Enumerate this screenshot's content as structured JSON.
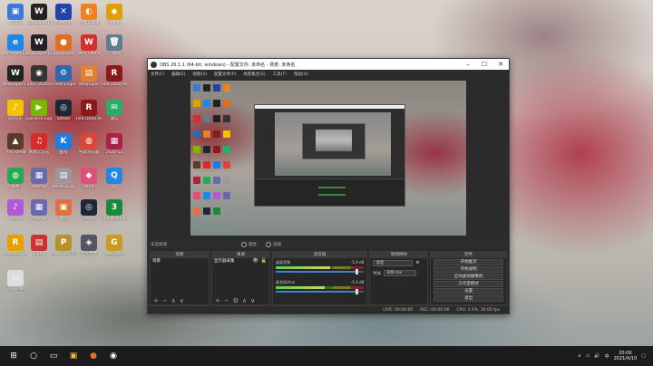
{
  "desktop": {
    "icons": [
      {
        "label": "此电脑",
        "glyph": "▣",
        "color": "#3a7bd5"
      },
      {
        "label": "Wallpaper Engine",
        "glyph": "W",
        "color": "#222"
      },
      {
        "label": "Minecraft",
        "glyph": "✕",
        "color": "#2244aa"
      },
      {
        "label": "小丸工具箱",
        "glyph": "◐",
        "color": "#f08020"
      },
      {
        "label": "Fences",
        "glyph": "◆",
        "color": "#e0a000"
      },
      {
        "label": "Microsoft Edge",
        "glyph": "e",
        "color": "#1e88e5"
      },
      {
        "label": "Wallpaper Engine",
        "glyph": "W",
        "color": "#222"
      },
      {
        "label": "Bandicam",
        "glyph": "●",
        "color": "#e07020"
      },
      {
        "label": "WPS Office",
        "glyph": "W",
        "color": "#d32f2f"
      },
      {
        "label": "回收站",
        "glyph": "🗑",
        "color": "#607d8b"
      },
      {
        "label": "Wallpaper Engine",
        "glyph": "W",
        "color": "#222"
      },
      {
        "label": "OBS Studio",
        "glyph": "◉",
        "color": "#333"
      },
      {
        "label": "Cheat Engine",
        "glyph": "⚙",
        "color": "#2a6ab3"
      },
      {
        "label": "Wallpaper",
        "glyph": "▤",
        "color": "#e08030"
      },
      {
        "label": "Red Dead Redemption",
        "glyph": "R",
        "color": "#8a1a1a"
      },
      {
        "label": "QQ音乐",
        "glyph": "♪",
        "color": "#f3c200"
      },
      {
        "label": "GeForce Experience",
        "glyph": "▶",
        "color": "#76b900"
      },
      {
        "label": "Steam",
        "glyph": "◎",
        "color": "#1b2838"
      },
      {
        "label": "Red Dead Redemption",
        "glyph": "R",
        "color": "#8a1a1a"
      },
      {
        "label": "微信",
        "glyph": "✉",
        "color": "#2aae67"
      },
      {
        "label": "The Forest",
        "glyph": "▲",
        "color": "#5b3a2a"
      },
      {
        "label": "网易云音乐",
        "glyph": "♫",
        "color": "#d52b2b"
      },
      {
        "label": "酷狗",
        "glyph": "K",
        "color": "#1d7de0"
      },
      {
        "label": "谷歌浏览器",
        "glyph": "◍",
        "color": "#db4437"
      },
      {
        "label": "2020-12",
        "glyph": "▦",
        "color": "#aa2244"
      },
      {
        "label": "网易",
        "glyph": "◍",
        "color": "#22aa55"
      },
      {
        "label": "desktop",
        "glyph": "▦",
        "color": "#6a6aaa"
      },
      {
        "label": "desktop.ini",
        "glyph": "▤",
        "color": "#999"
      },
      {
        "label": "Paint",
        "glyph": "◆",
        "color": "#e0507a"
      },
      {
        "label": "QQ",
        "glyph": "Q",
        "color": "#1e88e5"
      },
      {
        "label": "iTunes",
        "glyph": "♪",
        "color": "#b05ad8"
      },
      {
        "label": "desktop",
        "glyph": "▦",
        "color": "#6a6aaa"
      },
      {
        "label": "图片",
        "glyph": "▣",
        "color": "#e07040"
      },
      {
        "label": "Steam",
        "glyph": "◎",
        "color": "#1b2838"
      },
      {
        "label": "360 Wallpaper",
        "glyph": "3",
        "color": "#1a8a3a"
      },
      {
        "label": "Rockstar Games",
        "glyph": "R",
        "color": "#e8a000"
      },
      {
        "label": "1.png",
        "glyph": "▤",
        "color": "#c33"
      },
      {
        "label": "PUBG BATTLEGR",
        "glyph": "P",
        "color": "#b8912a"
      },
      {
        "label": "坦克世界",
        "glyph": "◈",
        "color": "#556"
      },
      {
        "label": "WeGame",
        "glyph": "G",
        "color": "#cc9a20"
      },
      {
        "label": "ThinkPad",
        "glyph": "▭",
        "color": "#ddd"
      }
    ]
  },
  "obs": {
    "title": "OBS 26.1.1 (64-bit, windows) - 配置文件: 未命名 - 场景: 未命名",
    "menu": [
      "文件(F)",
      "编辑(E)",
      "视图(V)",
      "配置文件(P)",
      "场景集合(S)",
      "工具(T)",
      "帮助(H)"
    ],
    "toolbar": {
      "label": "未选择源",
      "properties": "属性",
      "filters": "滤镜"
    },
    "scenes": {
      "header": "场景",
      "items": [
        "场景"
      ]
    },
    "sources": {
      "header": "来源",
      "items": [
        "显示器采集"
      ]
    },
    "mixer": {
      "header": "混音器",
      "channels": [
        {
          "name": "桌面音频",
          "db": "-5.4 dB",
          "level": 0.62,
          "volume": 0.92
        },
        {
          "name": "麦克风/Aux",
          "db": "-5.4 dB",
          "level": 0.55,
          "volume": 0.92
        }
      ]
    },
    "transitions": {
      "header": "转场特效",
      "type": "淡化",
      "duration_label": "时长",
      "duration": "300 ms"
    },
    "controls": {
      "header": "控件",
      "buttons": [
        "开始推流",
        "开始录制",
        "启动虚拟摄像机",
        "工作室模式",
        "设置",
        "退出"
      ]
    },
    "status": {
      "live": "LIVE: 00:00:00",
      "rec": "REC: 00:00:00",
      "cpu": "CPU: 2.4%, 30.00 fps"
    }
  },
  "taskbar": {
    "time": "20:06",
    "date": "2021/4/10"
  }
}
